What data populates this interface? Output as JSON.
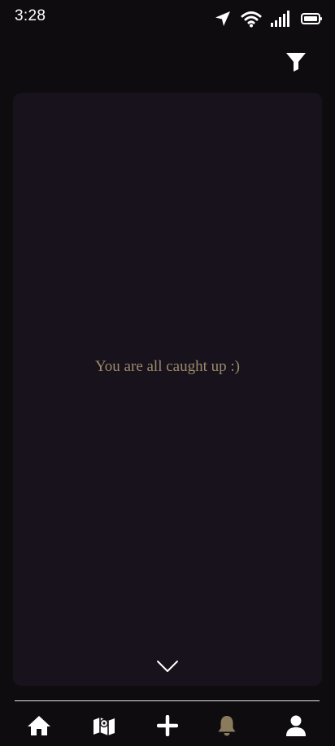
{
  "status_bar": {
    "time": "3:28",
    "icons": [
      "location-arrow-icon",
      "wifi-icon",
      "signal-icon",
      "battery-icon"
    ]
  },
  "header": {
    "filter_icon": "filter-icon"
  },
  "feed": {
    "empty_message": "You are all caught up :)",
    "scroll_icon": "chevron-down-icon"
  },
  "bottom_nav": {
    "items": [
      {
        "icon": "home-icon",
        "active": false
      },
      {
        "icon": "map-icon",
        "active": false
      },
      {
        "icon": "plus-icon",
        "active": false
      },
      {
        "icon": "bell-icon",
        "active": true
      },
      {
        "icon": "user-icon",
        "active": false
      }
    ]
  },
  "colors": {
    "background": "#0f0c10",
    "panel": "#17121b",
    "accent": "#9c8b6c",
    "icon": "#ffffff",
    "active_icon": "#8a7b5c"
  }
}
